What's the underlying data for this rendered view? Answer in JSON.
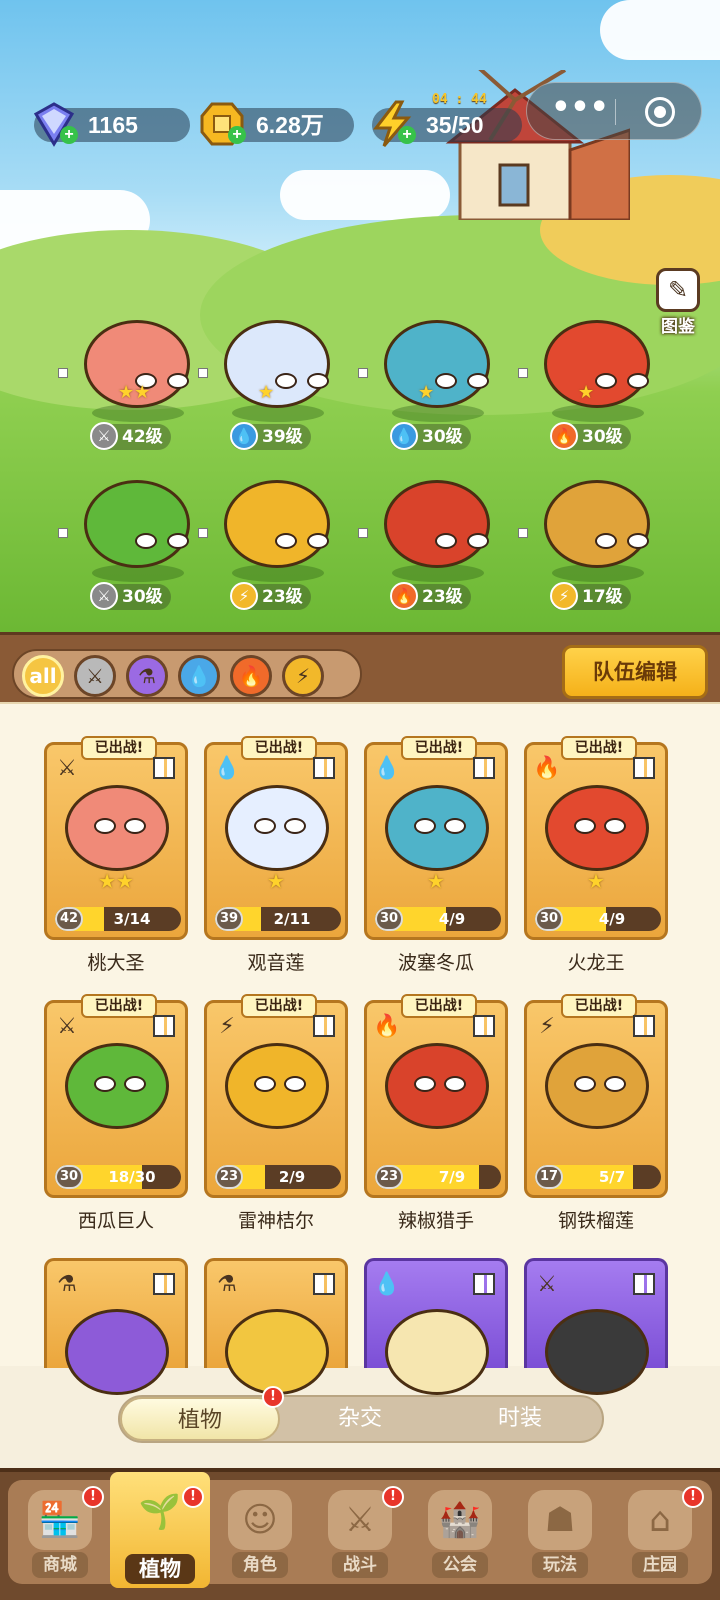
{
  "resources": [
    {
      "icon": "diamond-icon",
      "value": "1165"
    },
    {
      "icon": "gold-coin-icon",
      "value": "6.28万"
    },
    {
      "icon": "energy-bolt-icon",
      "value": "35/50",
      "timer": "04 : 44"
    }
  ],
  "capsule": {
    "menu": "•••"
  },
  "atlas": {
    "label": "图鉴"
  },
  "field": [
    {
      "element": "sword",
      "level": "42级",
      "color": "#f08a78",
      "stars": "★★"
    },
    {
      "element": "water",
      "level": "39级",
      "color": "#dce8fb",
      "stars": "★"
    },
    {
      "element": "water",
      "level": "30级",
      "color": "#4fb3c9",
      "stars": "★"
    },
    {
      "element": "fire",
      "level": "30级",
      "color": "#e2492f",
      "stars": "★"
    },
    {
      "element": "sword",
      "level": "30级",
      "color": "#5fb83a",
      "stars": ""
    },
    {
      "element": "lightning",
      "level": "23级",
      "color": "#f0b52a",
      "stars": ""
    },
    {
      "element": "fire",
      "level": "23级",
      "color": "#d9432b",
      "stars": ""
    },
    {
      "element": "lightning",
      "level": "17级",
      "color": "#e0a33a",
      "stars": ""
    }
  ],
  "filters": [
    {
      "id": "all",
      "label": "all",
      "color": "#f5c542"
    },
    {
      "id": "sword",
      "label": "⚔",
      "color": "#b9b9b9"
    },
    {
      "id": "poison",
      "label": "⚗",
      "color": "#9b6ae3"
    },
    {
      "id": "water",
      "label": "💧",
      "color": "#4aa8e8"
    },
    {
      "id": "fire",
      "label": "🔥",
      "color": "#f06a2a"
    },
    {
      "id": "lightning",
      "label": "⚡",
      "color": "#f2b82a"
    }
  ],
  "edit_button": "队伍编辑",
  "deployed_badge": "已出战!",
  "cards": [
    {
      "name": "桃大圣",
      "level": "42",
      "progress": "3/14",
      "fill": 0.21,
      "element": "⚔",
      "color": "#f08a78",
      "stars": "★★"
    },
    {
      "name": "观音莲",
      "level": "39",
      "progress": "2/11",
      "fill": 0.18,
      "element": "💧",
      "color": "#e6efff",
      "stars": "★"
    },
    {
      "name": "波塞冬瓜",
      "level": "30",
      "progress": "4/9",
      "fill": 0.44,
      "element": "💧",
      "color": "#4fb3c9",
      "stars": "★"
    },
    {
      "name": "火龙王",
      "level": "30",
      "progress": "4/9",
      "fill": 0.44,
      "element": "🔥",
      "color": "#e2492f",
      "stars": "★"
    },
    {
      "name": "西瓜巨人",
      "level": "30",
      "progress": "18/30",
      "fill": 0.6,
      "element": "⚔",
      "color": "#5fb83a",
      "stars": ""
    },
    {
      "name": "雷神桔尔",
      "level": "23",
      "progress": "2/9",
      "fill": 0.22,
      "element": "⚡",
      "color": "#f0b52a",
      "stars": ""
    },
    {
      "name": "辣椒猎手",
      "level": "23",
      "progress": "7/9",
      "fill": 0.78,
      "element": "🔥",
      "color": "#d9432b",
      "stars": ""
    },
    {
      "name": "钢铁榴莲",
      "level": "17",
      "progress": "5/7",
      "fill": 0.71,
      "element": "⚡",
      "color": "#e0a33a",
      "stars": ""
    }
  ],
  "partial_cards": [
    {
      "element": "⚗",
      "style": "gold",
      "color": "#8d5bd8"
    },
    {
      "element": "⚗",
      "style": "gold",
      "color": "#f2c640"
    },
    {
      "element": "💧",
      "style": "purple",
      "color": "#f6e6b0"
    },
    {
      "element": "⚔",
      "style": "purple",
      "color": "#3a3a3a"
    }
  ],
  "segment": [
    {
      "label": "植物",
      "active": true
    },
    {
      "label": "杂交",
      "active": false
    },
    {
      "label": "时装",
      "active": false
    }
  ],
  "nav": [
    {
      "label": "商城",
      "icon": "shop-icon",
      "glyph": "🏪",
      "badge": true
    },
    {
      "label": "植物",
      "icon": "plants-icon",
      "glyph": "🌱",
      "badge": true,
      "active": true
    },
    {
      "label": "角色",
      "icon": "character-icon",
      "glyph": "☺",
      "badge": false
    },
    {
      "label": "战斗",
      "icon": "battle-icon",
      "glyph": "⚔",
      "badge": true
    },
    {
      "label": "公会",
      "icon": "guild-icon",
      "glyph": "🏰",
      "badge": false
    },
    {
      "label": "玩法",
      "icon": "gameplay-icon",
      "glyph": "☗",
      "badge": false
    },
    {
      "label": "庄园",
      "icon": "manor-icon",
      "glyph": "⌂",
      "badge": true
    }
  ]
}
